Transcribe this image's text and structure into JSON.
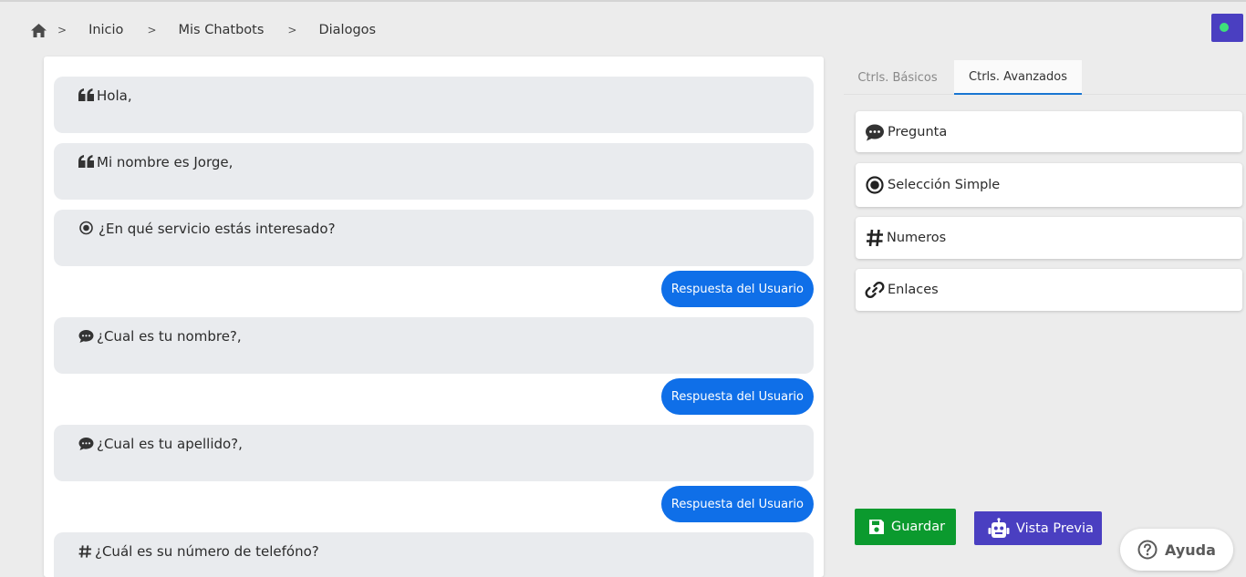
{
  "breadcrumb": {
    "separator": ">",
    "items": [
      "Inicio",
      "Mis Chatbots",
      "Dialogos"
    ]
  },
  "dialog": {
    "messages": [
      {
        "icon": "quote-icon",
        "text": "Hola,"
      },
      {
        "icon": "quote-icon",
        "text": "Mi nombre es Jorge,"
      },
      {
        "icon": "radio-icon",
        "text": "¿En qué servicio estás interesado?"
      },
      {
        "icon": "chat-bubble-icon",
        "text": "¿Cual es tu nombre?,"
      },
      {
        "icon": "chat-bubble-icon",
        "text": "¿Cual es tu apellido?,"
      },
      {
        "icon": "hash-icon",
        "text": "¿Cuál es su número de telefóno?"
      }
    ],
    "reply_label": "Respuesta del Usuario"
  },
  "tabs": [
    "Ctrls. Básicos",
    "Ctrls. Avanzados"
  ],
  "active_tab": "Ctrls. Avanzados",
  "controls": [
    {
      "icon": "chat-bubble-icon",
      "label": "Pregunta"
    },
    {
      "icon": "radio-icon",
      "label": "Selección Simple"
    },
    {
      "icon": "hash-icon",
      "label": "Numeros"
    },
    {
      "icon": "link-icon",
      "label": "Enlaces"
    }
  ],
  "actions": {
    "save_label": "Guardar",
    "preview_label": "Vista Previa"
  },
  "help": {
    "label": "Ayuda"
  },
  "colors": {
    "reply": "#0f6fe8",
    "save": "#0b9a2e",
    "preview": "#4a3fc1",
    "status_dot": "#3ee07a",
    "active_tab_underline": "#1976d2"
  }
}
